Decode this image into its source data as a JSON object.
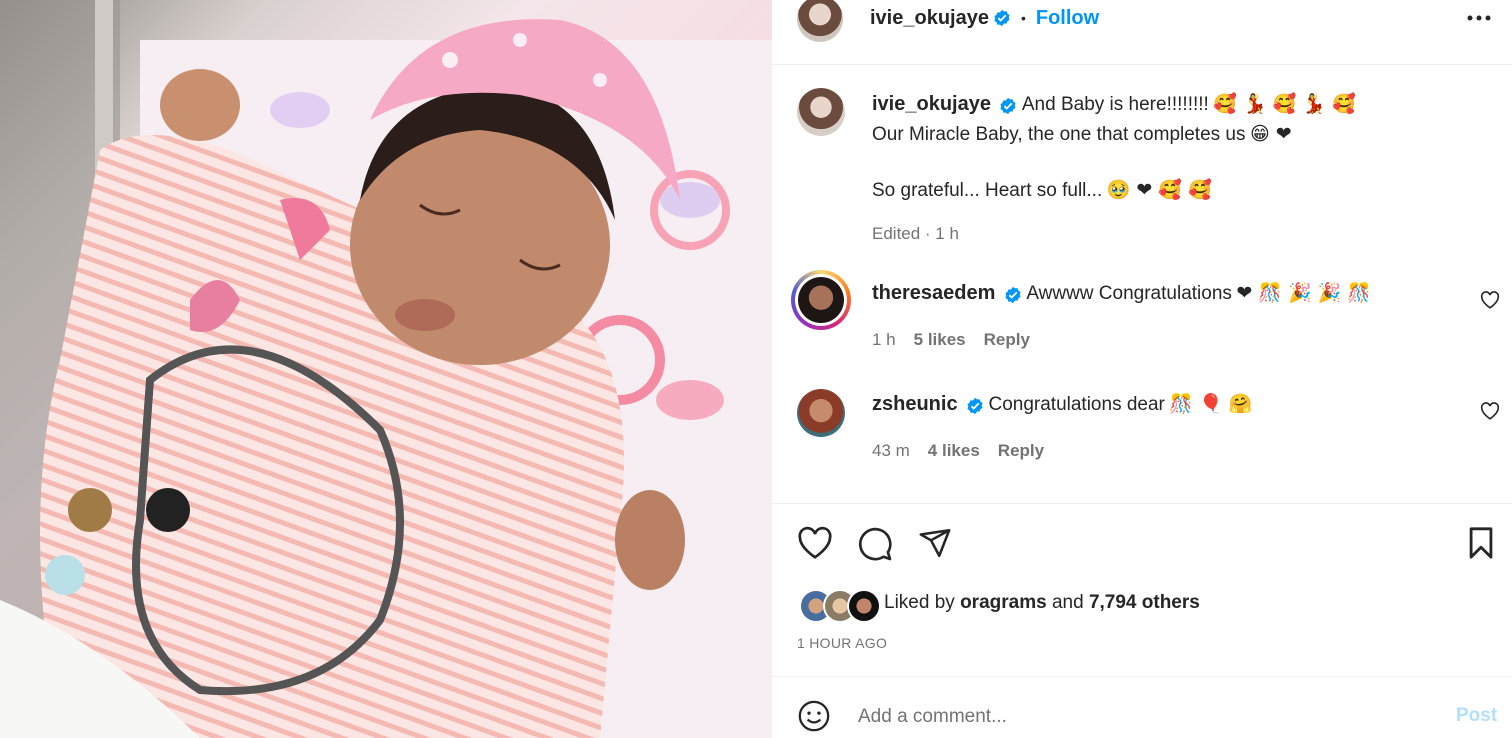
{
  "header": {
    "username": "ivie_okujaye",
    "separator": "•",
    "follow_label": "Follow",
    "more_icon": "more-horizontal-icon"
  },
  "caption": {
    "username": "ivie_okujaye",
    "line1": "And Baby is here!!!!!!!!",
    "line1_emoji": "🥰 💃 🥰 💃 🥰",
    "line2": "Our Miracle Baby, the one that completes us",
    "line2_emoji": "😁 ❤",
    "line3": "So grateful... Heart so full...",
    "line3_emoji": "🥹 ❤ 🥰 🥰",
    "meta": "Edited · 1 h"
  },
  "comments": [
    {
      "username": "theresaedem",
      "text": "Awwww Congratulations",
      "emoji": "❤ 🎊 🎉  🎉 🎊",
      "time": "1 h",
      "likes": "5 likes",
      "reply": "Reply"
    },
    {
      "username": "zsheunic",
      "text": "Congratulations dear",
      "emoji": "🎊 🎈 🤗",
      "time": "43 m",
      "likes": "4 likes",
      "reply": "Reply"
    }
  ],
  "actions": {
    "icons": [
      "heart-icon",
      "comment-icon",
      "share-icon",
      "bookmark-icon"
    ]
  },
  "likes": {
    "prefix": "Liked by",
    "user": "oragrams",
    "and": "and",
    "others": "7,794 others"
  },
  "timestamp": "1 HOUR AGO",
  "comment_box": {
    "placeholder": "Add a comment...",
    "post_label": "Post"
  },
  "colors": {
    "accent": "#0095f6",
    "post_disabled": "#b2dffc",
    "verified": "#0095f6"
  }
}
